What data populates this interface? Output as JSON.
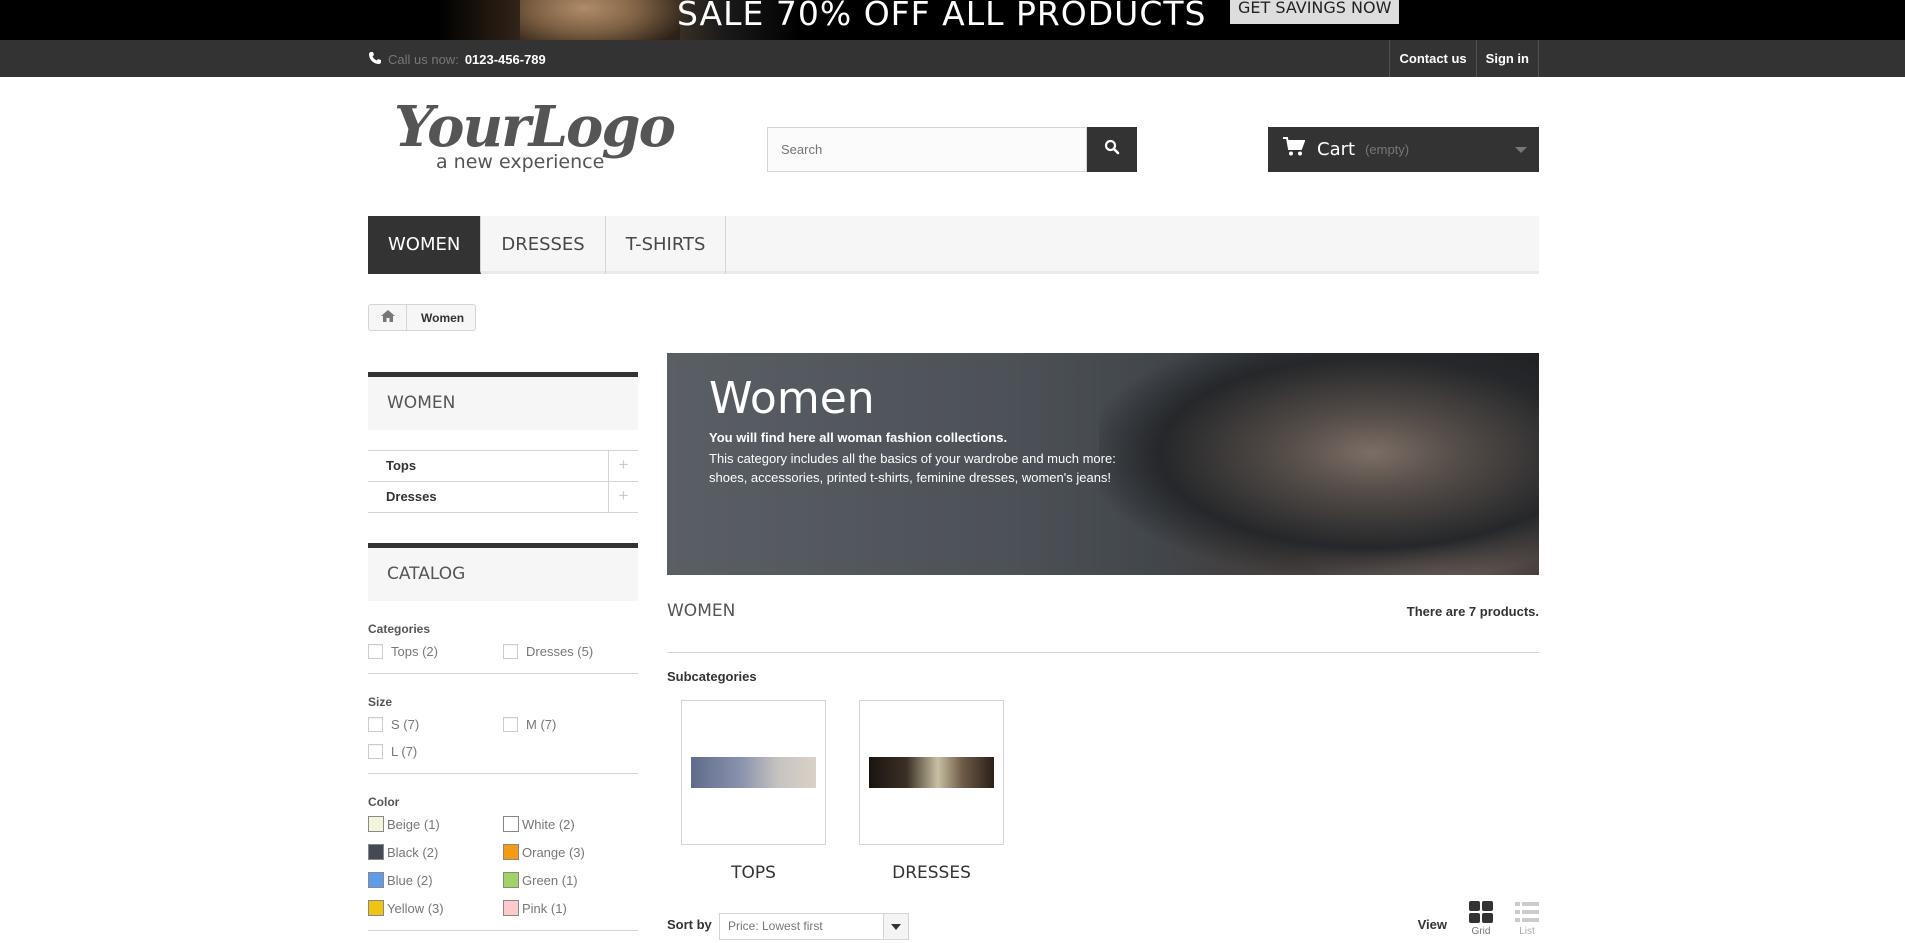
{
  "promo": {
    "headline": "SALE 70% OFF ALL PRODUCTS",
    "cta": "GET SAVINGS NOW"
  },
  "topbar": {
    "call_label": "Call us now:",
    "phone": "0123-456-789",
    "links": [
      "Contact us",
      "Sign in"
    ]
  },
  "header": {
    "logo_main": "YourLogo",
    "logo_sub": "a new experience",
    "search_placeholder": "Search",
    "cart_label": "Cart",
    "cart_status": "(empty)"
  },
  "menu": {
    "items": [
      {
        "label": "WOMEN",
        "active": true
      },
      {
        "label": "DRESSES",
        "active": false
      },
      {
        "label": "T-SHIRTS",
        "active": false
      }
    ]
  },
  "breadcrumb": {
    "current": "Women"
  },
  "sidebar": {
    "category_title": "WOMEN",
    "category_items": [
      "Tops",
      "Dresses"
    ],
    "catalog_title": "CATALOG",
    "filters": {
      "categories": {
        "title": "Categories",
        "items": [
          "Tops (2)",
          "Dresses (5)"
        ]
      },
      "size": {
        "title": "Size",
        "items": [
          "S (7)",
          "M (7)",
          "L (7)"
        ]
      },
      "color": {
        "title": "Color",
        "items": [
          {
            "label": "Beige (1)",
            "color": "#f5f5dc"
          },
          {
            "label": "White (2)",
            "color": "#ffffff"
          },
          {
            "label": "Black (2)",
            "color": "#434a54"
          },
          {
            "label": "Orange (3)",
            "color": "#f39c11"
          },
          {
            "label": "Blue (2)",
            "color": "#5d9cec"
          },
          {
            "label": "Green (1)",
            "color": "#a0d468"
          },
          {
            "label": "Yellow (3)",
            "color": "#f1c40f"
          },
          {
            "label": "Pink (1)",
            "color": "#fccacd"
          }
        ]
      }
    }
  },
  "content": {
    "banner_title": "Women",
    "banner_strong": "You will find here all woman fashion collections.",
    "banner_desc": "This category includes all the basics of your wardrobe and much more: shoes, accessories, printed t-shirts, feminine dresses, women's jeans!",
    "heading": "WOMEN",
    "product_count": "There are 7 products.",
    "subcategories_title": "Subcategories",
    "subcategories": [
      "TOPS",
      "DRESSES"
    ],
    "sort_label": "Sort by",
    "sort_value": "Price: Lowest first",
    "view_label": "View",
    "view_grid": "Grid",
    "view_list": "List"
  }
}
